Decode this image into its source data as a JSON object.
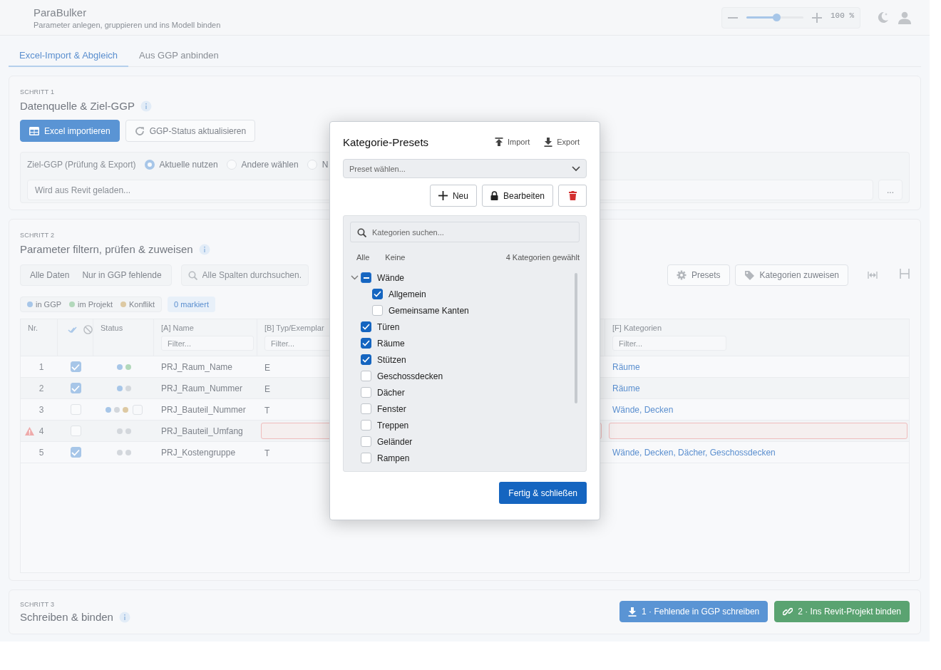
{
  "header": {
    "title": "ParaBulker",
    "subtitle": "Parameter anlegen, gruppieren und ins Modell binden",
    "zoom": {
      "level": 0.52,
      "reading": "100 %"
    }
  },
  "tabs": [
    {
      "label": "Excel-Import & Abgleich",
      "selected": true
    },
    {
      "label": "Aus GGP anbinden",
      "selected": false
    }
  ],
  "step1": {
    "step_label": "SCHRITT 1",
    "title": "Datenquelle & Ziel-GGP",
    "buttons": [
      {
        "label": "Excel importieren",
        "kind": "primary"
      },
      {
        "label": "GGP-Status aktualisieren",
        "kind": "refresh"
      }
    ],
    "target": {
      "label": "Ziel-GGP (Prüfung & Export)",
      "options": [
        {
          "label": "Aktuelle nutzen",
          "selected": true
        },
        {
          "label": "Andere wählen",
          "selected": false
        },
        {
          "label": "N",
          "selected": false
        }
      ],
      "path": {
        "placeholder": "Wird aus Revit geladen..."
      },
      "browse_button": "..."
    }
  },
  "step2": {
    "step_label": "SCHRITT 2",
    "title": "Parameter filtern, prüfen & zuweisen",
    "filters": [
      {
        "label": "Alle Daten",
        "selected": false
      },
      {
        "label": "Nur in GGP fehlende",
        "selected": false
      }
    ],
    "search": {
      "placeholder": "Alle Spalten durchsuchen."
    },
    "actions": [
      {
        "label": "Presets",
        "kind": "gear"
      },
      {
        "label": "Kategorien zuweisen",
        "kind": "tag"
      }
    ],
    "legend": [
      {
        "label": "in GGP",
        "color": "#a7c6e8"
      },
      {
        "label": "im Projekt",
        "color": "#b2d8bb"
      },
      {
        "label": "Konflikt",
        "color": "#ddc9a3"
      }
    ],
    "marked": "0 markiert",
    "table": {
      "columns": [
        {
          "label": "Nr."
        },
        {
          "kind": "select"
        },
        {
          "label": "Status"
        },
        {
          "label": "[A] Name",
          "filter": {
            "placeholder": "Filter..."
          }
        },
        {
          "label": "[B] Typ/Exemplar",
          "filter": {
            "placeholder": "Filter..."
          }
        },
        {
          "label": "[F] Kategorien",
          "filter": {
            "placeholder": "Filter..."
          }
        }
      ],
      "rows": [
        {
          "nr": "1",
          "warning": false,
          "checked": true,
          "status": [
            {
              "color": "#a7c6e8"
            },
            {
              "color": "#b2d8bb"
            }
          ],
          "flag": false,
          "name": "PRJ_Raum_Name",
          "type": "E",
          "categories": "Räume",
          "invalid": false
        },
        {
          "nr": "2",
          "warning": false,
          "checked": true,
          "status": [
            {
              "color": "#a7c6e8"
            },
            {
              "color": "#d3d7dc"
            }
          ],
          "flag": false,
          "name": "PRJ_Raum_Nummer",
          "type": "E",
          "categories": "Räume",
          "invalid": false
        },
        {
          "nr": "3",
          "warning": false,
          "checked": false,
          "status": [
            {
              "color": "#a7c6e8"
            },
            {
              "color": "#d3d7dc"
            },
            {
              "color": "#ddc9a3"
            }
          ],
          "flag": true,
          "name": "PRJ_Bauteil_Nummer",
          "type": "T",
          "categories": "Wände, Decken",
          "invalid": false
        },
        {
          "nr": "4",
          "warning": true,
          "checked": false,
          "status": [
            {
              "color": "#d3d7dc"
            },
            {
              "color": "#d3d7dc"
            }
          ],
          "flag": false,
          "name": "PRJ_Bauteil_Umfang",
          "invalid": true
        },
        {
          "nr": "5",
          "warning": false,
          "checked": true,
          "status": [
            {
              "color": "#d3d7dc"
            },
            {
              "color": "#d3d7dc"
            }
          ],
          "flag": false,
          "name": "PRJ_Kostengruppe",
          "type": "T",
          "categories": "Wände, Decken, Dächer, Geschossdecken",
          "invalid": false
        }
      ]
    }
  },
  "step3": {
    "step_label": "SCHRITT 3",
    "title": "Schreiben & binden",
    "buttons": [
      {
        "label": "1 · Fehlende in GGP schreiben",
        "kind": "write"
      },
      {
        "label": "2 · Ins Revit-Projekt binden",
        "kind": "bind"
      }
    ]
  },
  "dialog": {
    "title": "Kategorie-Presets",
    "links": [
      {
        "label": "Import",
        "kind": "upload"
      },
      {
        "label": "Export",
        "kind": "download"
      }
    ],
    "preset_select": {
      "placeholder": "Preset wählen..."
    },
    "buttons": [
      {
        "label": "Neu",
        "kind": "add"
      },
      {
        "label": "Bearbeiten",
        "kind": "edit"
      },
      {
        "kind": "delete"
      }
    ],
    "search": {
      "placeholder": "Kategorien suchen..."
    },
    "select_all": "Alle",
    "select_none": "Keine",
    "count": "4 Kategorien gewählt",
    "categories": [
      {
        "label": "Wände",
        "checked": false,
        "partial": true,
        "expanded": true,
        "children": [
          {
            "label": "Allgemein",
            "checked": true,
            "partial": false
          },
          {
            "label": "Gemeinsame Kanten",
            "checked": false,
            "partial": false
          }
        ]
      },
      {
        "label": "Türen",
        "checked": true,
        "partial": false
      },
      {
        "label": "Räume",
        "checked": true,
        "partial": false
      },
      {
        "label": "Stützen",
        "checked": true,
        "partial": false
      },
      {
        "label": "Geschossdecken",
        "checked": false,
        "partial": false
      },
      {
        "label": "Dächer",
        "checked": false,
        "partial": false
      },
      {
        "label": "Fenster",
        "checked": false,
        "partial": false
      },
      {
        "label": "Treppen",
        "checked": false,
        "partial": false
      },
      {
        "label": "Geländer",
        "checked": false,
        "partial": false
      },
      {
        "label": "Rampen",
        "checked": false,
        "partial": false
      }
    ],
    "done_button": "Fertig & schließen"
  }
}
